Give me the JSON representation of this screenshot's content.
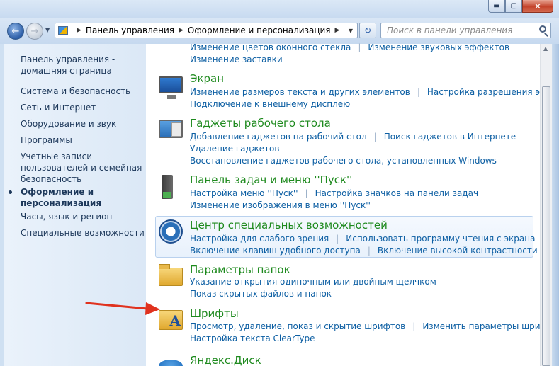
{
  "window": {
    "minimize_glyph": "▬",
    "maximize_glyph": "▢",
    "close_glyph": "✕"
  },
  "nav": {
    "back_glyph": "←",
    "forward_glyph": "→",
    "dropdown_glyph": "▼",
    "refresh_glyph": "↻",
    "breadcrumb_sep": "▶",
    "breadcrumbs": [
      "Панель управления",
      "Оформление и персонализация"
    ],
    "search_placeholder": "Поиск в панели управления"
  },
  "sidebar": {
    "home": "Панель управления -\nдомашняя страница",
    "items": [
      "Система и безопасность",
      "Сеть и Интернет",
      "Оборудование и звук",
      "Программы",
      "Учетные записи\nпользователей и семейная\nбезопасность",
      "Оформление и\nперсонализация",
      "Часы, язык и регион",
      "Специальные возможности"
    ],
    "active_index": 5
  },
  "categories": {
    "top": {
      "links_row1": [
        "Изменение цветов оконного стекла",
        "Изменение звуковых эффектов"
      ],
      "links_row2": [
        "Изменение заставки"
      ]
    },
    "screen": {
      "title": "Экран",
      "links_row1": [
        "Изменение размеров текста и других элементов",
        "Настройка разрешения экрана"
      ],
      "links_row2": [
        "Подключение к внешнему дисплею"
      ]
    },
    "gadgets": {
      "title": "Гаджеты рабочего стола",
      "links_row1": [
        "Добавление гаджетов на рабочий стол",
        "Поиск гаджетов в Интернете"
      ],
      "links_row2": [
        "Удаление гаджетов"
      ],
      "links_row3": [
        "Восстановление гаджетов рабочего стола, установленных Windows"
      ]
    },
    "taskbar": {
      "title": "Панель задач и меню ''Пуск''",
      "links_row1": [
        "Настройка меню ''Пуск''",
        "Настройка значков на панели задач"
      ],
      "links_row2": [
        "Изменение изображения в меню ''Пуск''"
      ]
    },
    "access": {
      "title": "Центр специальных возможностей",
      "links_row1": [
        "Настройка для слабого зрения",
        "Использовать программу чтения с экрана"
      ],
      "links_row2": [
        "Включение клавиш удобного доступа",
        "Включение высокой контрастности"
      ]
    },
    "folders": {
      "title": "Параметры папок",
      "links_row1": [
        "Указание открытия одиночным или двойным щелчком"
      ],
      "links_row2": [
        "Показ скрытых файлов и папок"
      ]
    },
    "fonts": {
      "title": "Шрифты",
      "links_row1": [
        "Просмотр, удаление, показ и скрытие шрифтов",
        "Изменить параметры шрифта"
      ],
      "links_row2": [
        "Настройка текста ClearType"
      ],
      "font_icon_letter": "A"
    },
    "disk": {
      "title": "Яндекс.Диск"
    }
  },
  "colors": {
    "title_green": "#1e8a1e",
    "link_blue": "#0d5fa3",
    "arrow_red": "#e0321e"
  }
}
